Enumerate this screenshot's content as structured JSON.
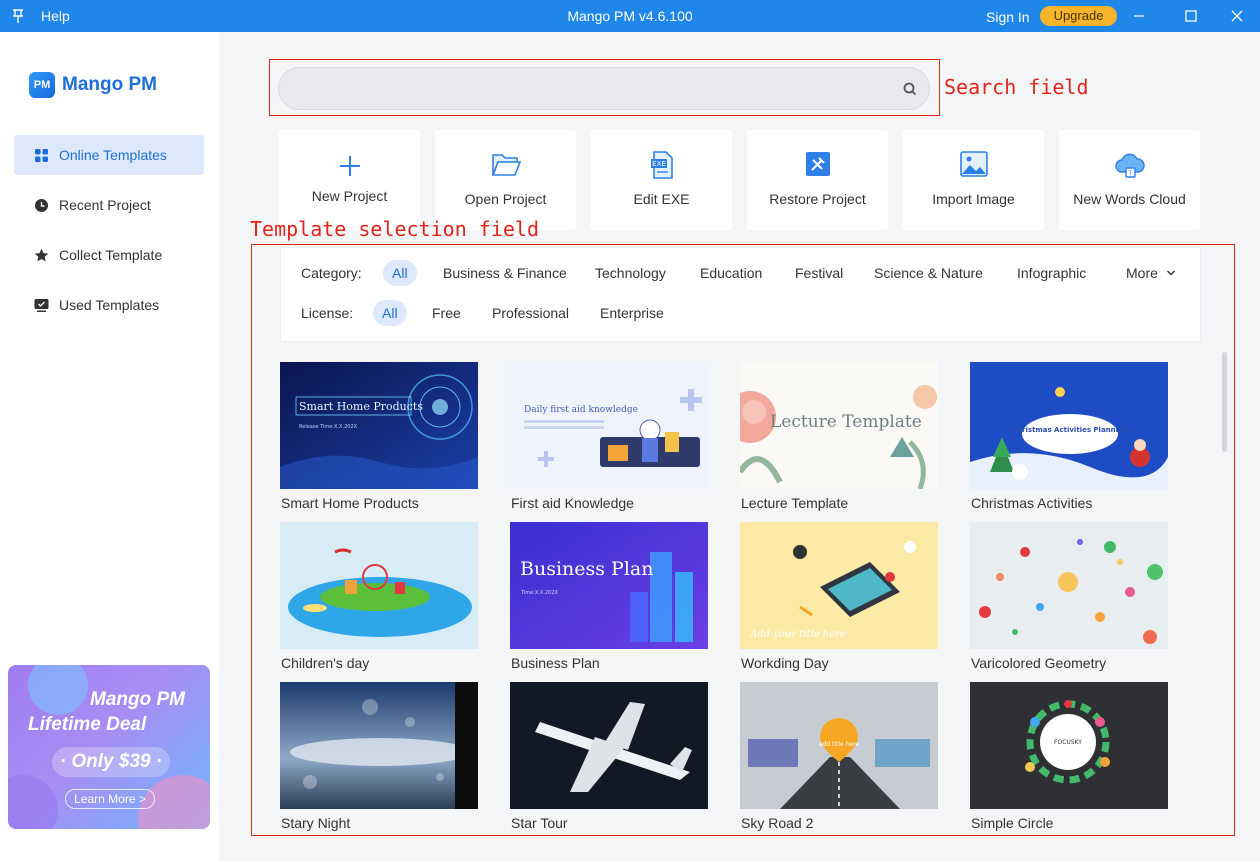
{
  "titlebar": {
    "help": "Help",
    "title": "Mango PM v4.6.100",
    "sign_in": "Sign In",
    "upgrade": "Upgrade"
  },
  "sidebar": {
    "logo_badge": "PM",
    "logo_text": "Mango PM",
    "items": [
      {
        "label": "Online Templates",
        "icon": "grid-icon",
        "active": true
      },
      {
        "label": "Recent Project",
        "icon": "clock-icon",
        "active": false
      },
      {
        "label": "Collect Template",
        "icon": "star-icon",
        "active": false
      },
      {
        "label": "Used Templates",
        "icon": "monitor-check-icon",
        "active": false
      }
    ],
    "promo": {
      "line1": "Mango PM",
      "line2": "Lifetime Deal",
      "price": "· Only $39 ·",
      "button": "Learn More >"
    }
  },
  "search": {
    "placeholder": "",
    "annotation": "Search field"
  },
  "actions": [
    {
      "label": "New Project",
      "icon": "plus-icon"
    },
    {
      "label": "Open Project",
      "icon": "folder-open-icon"
    },
    {
      "label": "Edit EXE",
      "icon": "exe-file-icon"
    },
    {
      "label": "Restore Project",
      "icon": "tools-icon"
    },
    {
      "label": "Import Image",
      "icon": "image-icon"
    },
    {
      "label": "New Words Cloud",
      "icon": "cloud-icon"
    }
  ],
  "template_area": {
    "annotation": "Template selection field",
    "category_label": "Category:",
    "categories": [
      "All",
      "Business & Finance",
      "Technology",
      "Education",
      "Festival",
      "Science & Nature",
      "Infographic",
      "More"
    ],
    "license_label": "License:",
    "licenses": [
      "All",
      "Free",
      "Professional",
      "Enterprise"
    ],
    "templates": [
      {
        "name": "Smart Home Products",
        "thumb_text": "Smart Home Products",
        "thumb_sub": "Release Time:X.X.202X"
      },
      {
        "name": "First aid Knowledge",
        "thumb_text": "Daily first aid knowledge",
        "thumb_sub": ""
      },
      {
        "name": "Lecture Template",
        "thumb_text": "Lecture Template",
        "thumb_sub": ""
      },
      {
        "name": "Christmas Activities",
        "thumb_text": "Christmas Activities Planning",
        "thumb_sub": ""
      },
      {
        "name": "Children's day",
        "thumb_text": "",
        "thumb_sub": ""
      },
      {
        "name": "Business Plan",
        "thumb_text": "Business Plan",
        "thumb_sub": "Time:X.X.202X"
      },
      {
        "name": "Workding Day",
        "thumb_text": "Add your title here",
        "thumb_sub": ""
      },
      {
        "name": "Varicolored Geometry",
        "thumb_text": "",
        "thumb_sub": ""
      },
      {
        "name": "Stary Night",
        "thumb_text": "",
        "thumb_sub": ""
      },
      {
        "name": "Star Tour",
        "thumb_text": "",
        "thumb_sub": ""
      },
      {
        "name": "Sky Road 2",
        "thumb_text": "add title here",
        "thumb_sub": ""
      },
      {
        "name": "Simple Circle",
        "thumb_text": "FOCUSKY",
        "thumb_sub": ""
      }
    ]
  },
  "colors": {
    "titlebar": "#1f86ea",
    "accent": "#1f6fd8",
    "upgrade": "#f7b52b",
    "annotation": "#e0241b"
  }
}
